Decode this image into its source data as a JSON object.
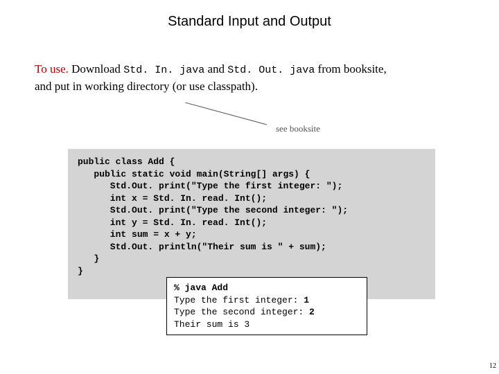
{
  "title": "Standard Input and Output",
  "desc": {
    "label": "To use.",
    "pre": "  Download ",
    "file1": "Std. In. java",
    "mid1": " and ",
    "file2": "Std. Out. java",
    "post1": "  from booksite,",
    "line2": "and put in working directory (or use classpath)."
  },
  "annotation": "see booksite",
  "code": "public class Add {\n   public static void main(String[] args) {\n      Std.Out. print(\"Type the first integer: \");\n      int x = Std. In. read. Int();\n      Std.Out. print(\"Type the second integer: \");\n      int y = Std. In. read. Int();\n      int sum = x + y;\n      Std.Out. println(\"Their sum is \" + sum);\n   }\n}",
  "output": {
    "cmd": "% java Add",
    "l1a": "Type the first integer: ",
    "l1b": "1",
    "l2a": "Type the second integer: ",
    "l2b": "2",
    "l3": "Their sum is 3"
  },
  "pagenum": "12"
}
